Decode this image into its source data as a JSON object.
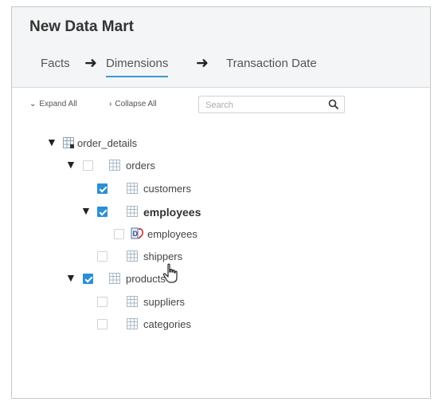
{
  "window": {
    "title": "New Data Mart"
  },
  "steps": [
    {
      "label": "Facts",
      "active": false
    },
    {
      "label": "Dimensions",
      "active": true
    },
    {
      "label": "Transaction Date",
      "active": false
    }
  ],
  "toolbar": {
    "expand_all": "Expand All",
    "collapse_all": "Collapse All",
    "search_placeholder": "Search"
  },
  "tree": [
    {
      "label": "order_details",
      "icon": "table-key-icon",
      "expanded": true,
      "checkbox": false
    },
    {
      "label": "orders",
      "icon": "table-icon",
      "expanded": true,
      "checked": false
    },
    {
      "label": "customers",
      "icon": "table-icon",
      "checked": true
    },
    {
      "label": "employees",
      "icon": "table-icon",
      "expanded": true,
      "checked": true,
      "bold": true
    },
    {
      "label": "employees",
      "icon": "data-view-icon",
      "checked": false
    },
    {
      "label": "shippers",
      "icon": "table-icon",
      "checked": false
    },
    {
      "label": "products",
      "icon": "table-icon",
      "expanded": true,
      "checked": true
    },
    {
      "label": "suppliers",
      "icon": "table-icon",
      "checked": false
    },
    {
      "label": "categories",
      "icon": "table-icon",
      "checked": false
    }
  ],
  "colors": {
    "accent": "#2b8fd6",
    "header_bg": "#f4f5f6"
  }
}
